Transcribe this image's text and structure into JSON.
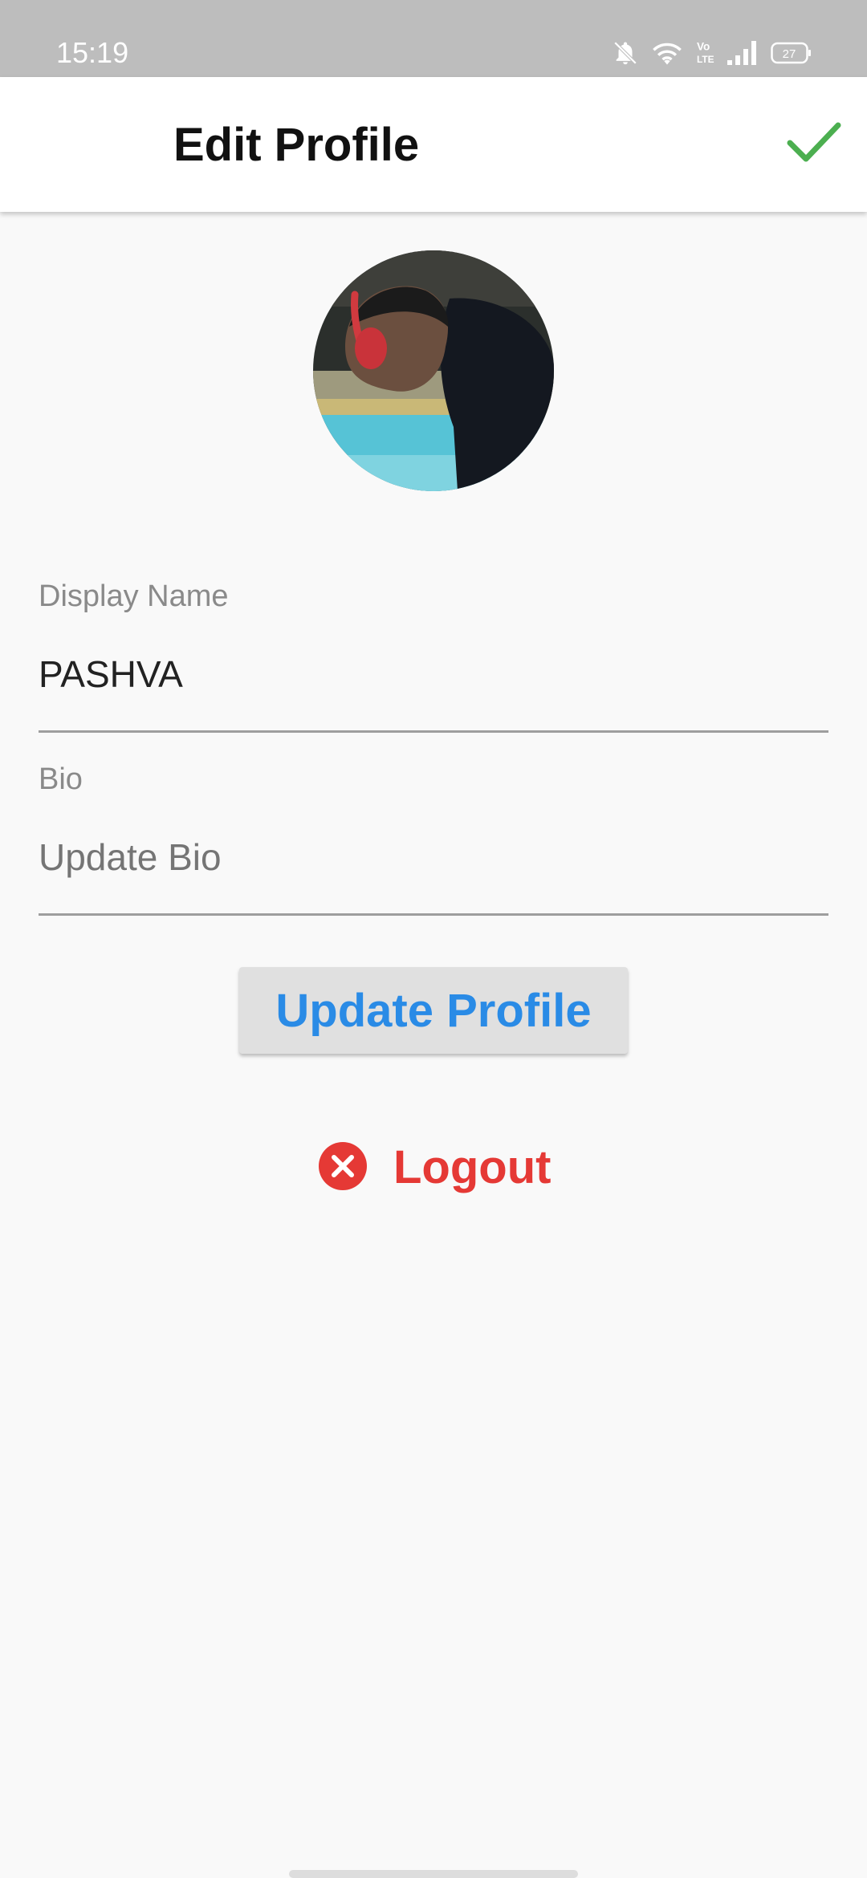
{
  "status_bar": {
    "time": "15:19",
    "battery": "27",
    "icons": [
      "bell-off-icon",
      "wifi-icon",
      "volte-icon",
      "signal-icon",
      "battery-icon"
    ]
  },
  "app_bar": {
    "title": "Edit Profile",
    "confirm_icon": "checkmark-icon"
  },
  "profile": {
    "avatar": "profile-photo"
  },
  "display_name": {
    "label": "Display Name",
    "value": "PASHVA"
  },
  "bio": {
    "label": "Bio",
    "placeholder": "Update Bio",
    "value": ""
  },
  "actions": {
    "update_label": "Update Profile",
    "logout_label": "Logout",
    "logout_icon": "cancel-circle-icon"
  },
  "colors": {
    "status_bar": "#bdbdbd",
    "accent_blue": "#2a8be6",
    "logout_red": "#e53935",
    "confirm_green": "#4caf50"
  }
}
